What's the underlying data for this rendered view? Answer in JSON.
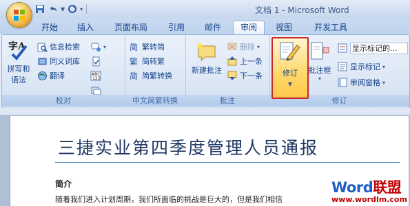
{
  "window": {
    "title": "文档 1 - Microsoft Word"
  },
  "tabs": [
    {
      "label": "开始"
    },
    {
      "label": "插入"
    },
    {
      "label": "页面布局"
    },
    {
      "label": "引用"
    },
    {
      "label": "邮件"
    },
    {
      "label": "审阅"
    },
    {
      "label": "视图"
    },
    {
      "label": "开发工具"
    }
  ],
  "active_tab": "审阅",
  "ribbon": {
    "proofing": {
      "label": "校对",
      "spelling": {
        "line1": "拼写和",
        "line2": "语法"
      },
      "research": "信息检索",
      "thesaurus": "同义词库",
      "translate": "翻译"
    },
    "chinese_conversion": {
      "label": "中文简繁转换",
      "to_traditional": "繁转简",
      "to_simplified": "简转繁",
      "conversion": "简繁转换"
    },
    "comments": {
      "label": "批注",
      "new_comment": "新建批注",
      "delete": "删除",
      "previous": "上一条",
      "next": "下一条"
    },
    "tracking": {
      "label": "修订",
      "track_changes": "修订",
      "balloons": "批注框",
      "display_markup": "显示标记的...",
      "show_markup": "显示标记",
      "reviewing_pane": "审阅窗格"
    }
  },
  "document": {
    "heading": "三捷实业第四季度管理人员通报",
    "subheading": "简介",
    "body": "随着我们进入计划周期，我们所面临的挑战是巨大的，但是我们相信"
  },
  "watermark": {
    "word": "Word",
    "cn": "联盟",
    "url": "www.wordlm.com"
  },
  "colors": {
    "highlight_border": "#c8282c",
    "ribbon_text": "#15428b",
    "heading": "#1f3763"
  }
}
